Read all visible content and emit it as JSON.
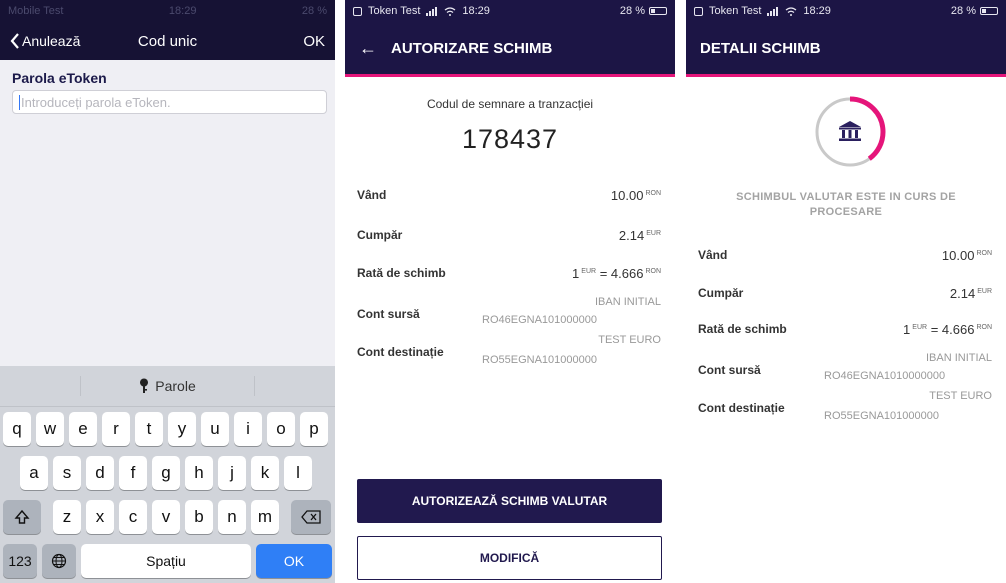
{
  "screen1": {
    "status": {
      "carrier": "Mobile Test",
      "time": "18:29",
      "battery": "28 %"
    },
    "nav": {
      "back_label": "Anulează",
      "title": "Cod unic",
      "ok_label": "OK"
    },
    "field": {
      "label": "Parola eToken",
      "placeholder": "Introduceți parola eToken."
    },
    "keyboard": {
      "suggestion": "Parole",
      "row1": [
        "q",
        "w",
        "e",
        "r",
        "t",
        "y",
        "u",
        "i",
        "o",
        "p"
      ],
      "row2": [
        "a",
        "s",
        "d",
        "f",
        "g",
        "h",
        "j",
        "k",
        "l"
      ],
      "row3": [
        "z",
        "x",
        "c",
        "v",
        "b",
        "n",
        "m"
      ],
      "numbers_key": "123",
      "space_key": "Spațiu",
      "return_key": "OK"
    }
  },
  "screen2": {
    "status": {
      "carrier": "Token Test",
      "time": "18:29",
      "battery": "28 %"
    },
    "header": {
      "title": "AUTORIZARE SCHIMB"
    },
    "code": {
      "caption": "Codul de semnare a tranzacției",
      "value": "178437"
    },
    "rows": {
      "sell": {
        "label": "Vând",
        "amount": "10.00",
        "unit": "RON"
      },
      "buy": {
        "label": "Cumpăr",
        "amount": "2.14",
        "unit": "EUR"
      },
      "rate": {
        "label": "Rată de schimb",
        "prefix": "1",
        "unit_from": "EUR",
        "middle": "= 4.666",
        "unit_to": "RON"
      },
      "source": {
        "label": "Cont sursă",
        "name": "IBAN INITIAL",
        "iban": "RO46EGNA101000000"
      },
      "dest": {
        "label": "Cont destinație",
        "name": "TEST EURO",
        "iban": "RO55EGNA101000000"
      }
    },
    "buttons": {
      "authorize": "AUTORIZEAZĂ SCHIMB VALUTAR",
      "modify": "MODIFICĂ"
    }
  },
  "screen3": {
    "status": {
      "carrier": "Token Test",
      "time": "18:29",
      "battery": "28 %"
    },
    "header": {
      "title": "DETALII SCHIMB"
    },
    "progress": 0.4,
    "processing_text": "SCHIMBUL VALUTAR ESTE IN CURS DE PROCESARE",
    "rows": {
      "sell": {
        "label": "Vând",
        "amount": "10.00",
        "unit": "RON"
      },
      "buy": {
        "label": "Cumpăr",
        "amount": "2.14",
        "unit": "EUR"
      },
      "rate": {
        "label": "Rată de schimb",
        "prefix": "1",
        "unit_from": "EUR",
        "middle": "= 4.666",
        "unit_to": "RON"
      },
      "source": {
        "label": "Cont sursă",
        "name": "IBAN INITIAL",
        "iban": "RO46EGNA1010000000"
      },
      "dest": {
        "label": "Cont destinație",
        "name": "TEST EURO",
        "iban": "RO55EGNA101000000"
      }
    }
  },
  "colors": {
    "brand_navy": "#1c1545",
    "accent_pink": "#e5157a",
    "ios_blue": "#2f7ff6"
  },
  "icons": {
    "bank": "bank-building-icon",
    "back": "arrow-left-icon",
    "wifi": "wifi-icon",
    "signal": "signal-icon"
  }
}
